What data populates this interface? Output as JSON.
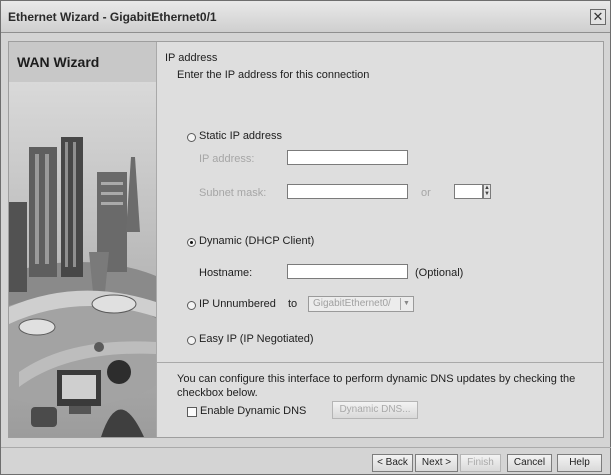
{
  "window": {
    "title": "Ethernet Wizard - GigabitEthernet0/1",
    "close_glyph": "✕"
  },
  "sidebar": {
    "title": "WAN Wizard"
  },
  "section": {
    "title": "IP address",
    "description": "Enter the IP address for this connection"
  },
  "static_ip": {
    "label": "Static IP address",
    "selected": false,
    "ip_label": "IP address:",
    "ip_value": "",
    "mask_label": "Subnet mask:",
    "mask_value": "",
    "or_label": "or",
    "prefix_value": ""
  },
  "dhcp": {
    "label": "Dynamic (DHCP Client)",
    "selected": true,
    "hostname_label": "Hostname:",
    "hostname_value": "",
    "optional_label": "(Optional)"
  },
  "unnumbered": {
    "label": "IP Unnumbered",
    "to_label": "to",
    "selected": false,
    "interface_value": "GigabitEthernet0/"
  },
  "easy_ip": {
    "label": "Easy IP (IP Negotiated)",
    "selected": false
  },
  "dns": {
    "info": "You can configure this interface to perform dynamic DNS updates by checking the",
    "info2": "checkbox below.",
    "checkbox_label": "Enable Dynamic DNS",
    "checked": false,
    "button_label": "Dynamic DNS..."
  },
  "footer": {
    "back": "< Back",
    "next": "Next >",
    "finish": "Finish",
    "cancel": "Cancel",
    "help": "Help"
  },
  "colors": {
    "window_bg": "#d4d4d4",
    "panel_bg": "#dedede",
    "disabled_text": "#a6a6a6"
  }
}
